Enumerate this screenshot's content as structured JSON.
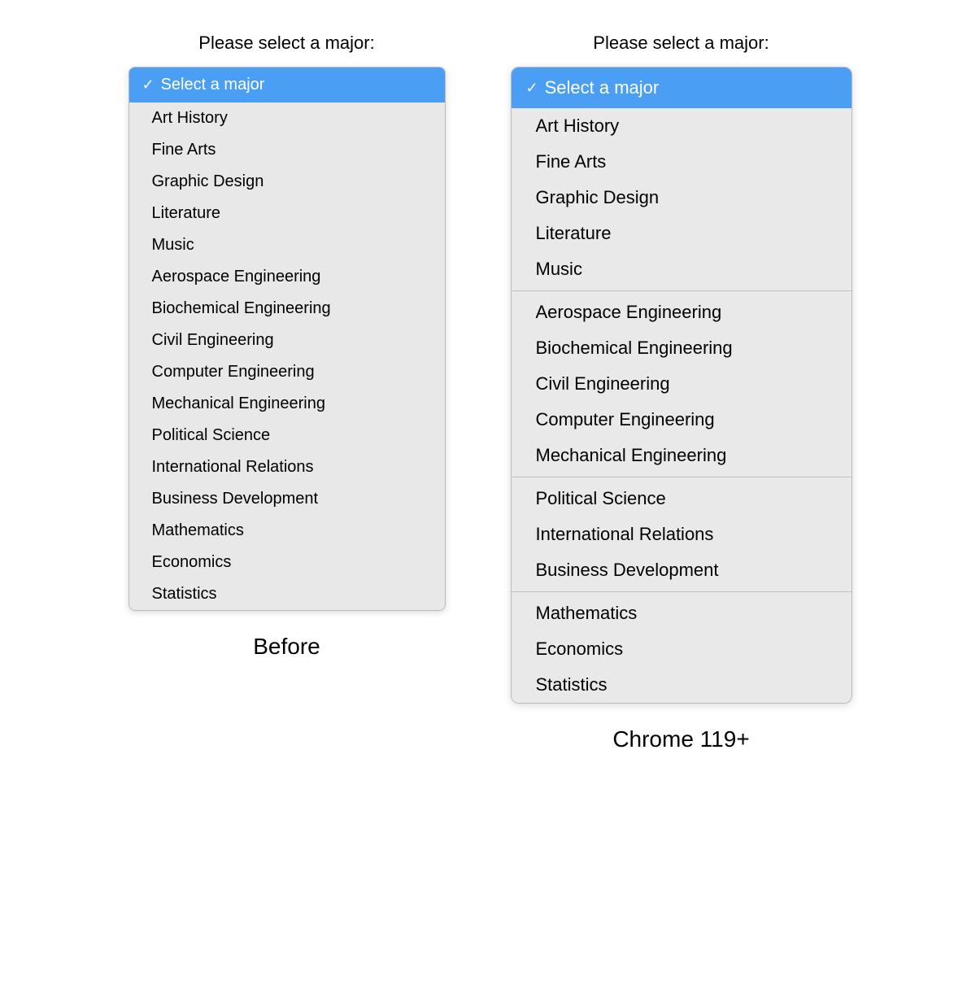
{
  "before": {
    "column_label": "Before",
    "prompt": "Please select a major:",
    "selected": "Select a major",
    "options": [
      "Art History",
      "Fine Arts",
      "Graphic Design",
      "Literature",
      "Music",
      "Aerospace Engineering",
      "Biochemical Engineering",
      "Civil Engineering",
      "Computer Engineering",
      "Mechanical Engineering",
      "Political Science",
      "International Relations",
      "Business Development",
      "Mathematics",
      "Economics",
      "Statistics"
    ]
  },
  "after": {
    "column_label": "Chrome 119+",
    "prompt": "Please select a major:",
    "selected": "Select a major",
    "groups": [
      {
        "options": [
          "Art History",
          "Fine Arts",
          "Graphic Design",
          "Literature",
          "Music"
        ]
      },
      {
        "options": [
          "Aerospace Engineering",
          "Biochemical Engineering",
          "Civil Engineering",
          "Computer Engineering",
          "Mechanical Engineering"
        ]
      },
      {
        "options": [
          "Political Science",
          "International Relations",
          "Business Development"
        ]
      },
      {
        "options": [
          "Mathematics",
          "Economics",
          "Statistics"
        ]
      }
    ]
  }
}
